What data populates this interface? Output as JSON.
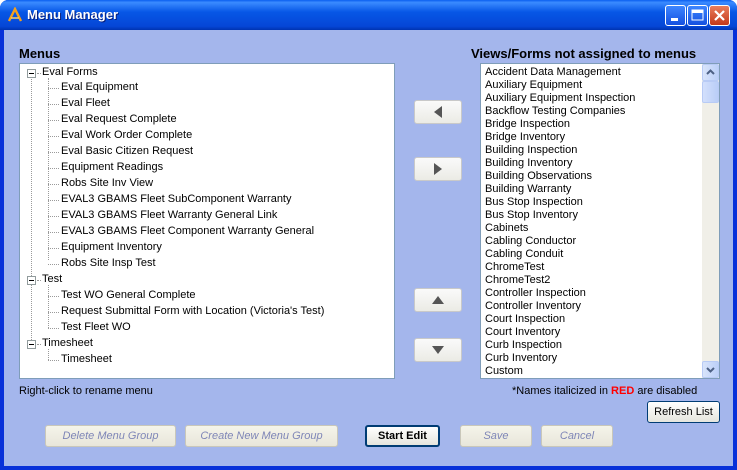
{
  "window": {
    "title": "Menu Manager",
    "app_icon": "menu-manager-app-icon",
    "caption_buttons": [
      "minimize-icon",
      "maximize-icon",
      "close-icon"
    ]
  },
  "menus": {
    "label": "Menus",
    "groups": [
      {
        "label": "Eval Forms",
        "expanded": true,
        "items": [
          "Eval Equipment",
          "Eval Fleet",
          "Eval Request Complete",
          "Eval Work Order Complete",
          "Eval Basic Citizen Request",
          "Equipment Readings",
          "Robs Site Inv View",
          "EVAL3 GBAMS Fleet SubComponent Warranty",
          "EVAL3 GBAMS Fleet Warranty General Link",
          "EVAL3 GBAMS Fleet Component Warranty General",
          "Equipment Inventory",
          "Robs Site Insp Test"
        ]
      },
      {
        "label": "Test",
        "expanded": true,
        "items": [
          "Test WO General Complete",
          "Request Submittal Form with Location (Victoria's Test)",
          "Test Fleet WO"
        ]
      },
      {
        "label": "Timesheet",
        "expanded": true,
        "items": [
          "Timesheet"
        ]
      }
    ],
    "hint": "Right-click to rename menu"
  },
  "unassigned": {
    "label": "Views/Forms not assigned to menus",
    "items": [
      "Accident Data Management",
      "Auxiliary Equipment",
      "Auxiliary Equipment Inspection",
      "Backflow Testing Companies",
      "Bridge Inspection",
      "Bridge Inventory",
      "Building Inspection",
      "Building Inventory",
      "Building Observations",
      "Building Warranty",
      "Bus Stop Inspection",
      "Bus Stop Inventory",
      "Cabinets",
      "Cabling Conductor",
      "Cabling Conduit",
      "ChromeTest",
      "ChromeTest2",
      "Controller Inspection",
      "Controller Inventory",
      "Court Inspection",
      "Court Inventory",
      "Curb Inspection",
      "Curb Inventory",
      "Custom"
    ],
    "note_prefix": "*Names italicized in ",
    "note_red": "RED",
    "note_suffix": " are disabled"
  },
  "transfer_buttons": [
    "move-left-arrow-icon",
    "move-right-arrow-icon",
    "move-up-arrow-icon",
    "move-down-arrow-icon"
  ],
  "buttons": {
    "refresh": "Refresh List",
    "delete_group": "Delete Menu Group",
    "create_group": "Create New Menu Group",
    "start_edit": "Start Edit",
    "save": "Save",
    "cancel": "Cancel"
  },
  "colors": {
    "client_bg": "#a4b6ec",
    "title_bar": "#0546d6",
    "disabled_note": "#ff0000"
  }
}
